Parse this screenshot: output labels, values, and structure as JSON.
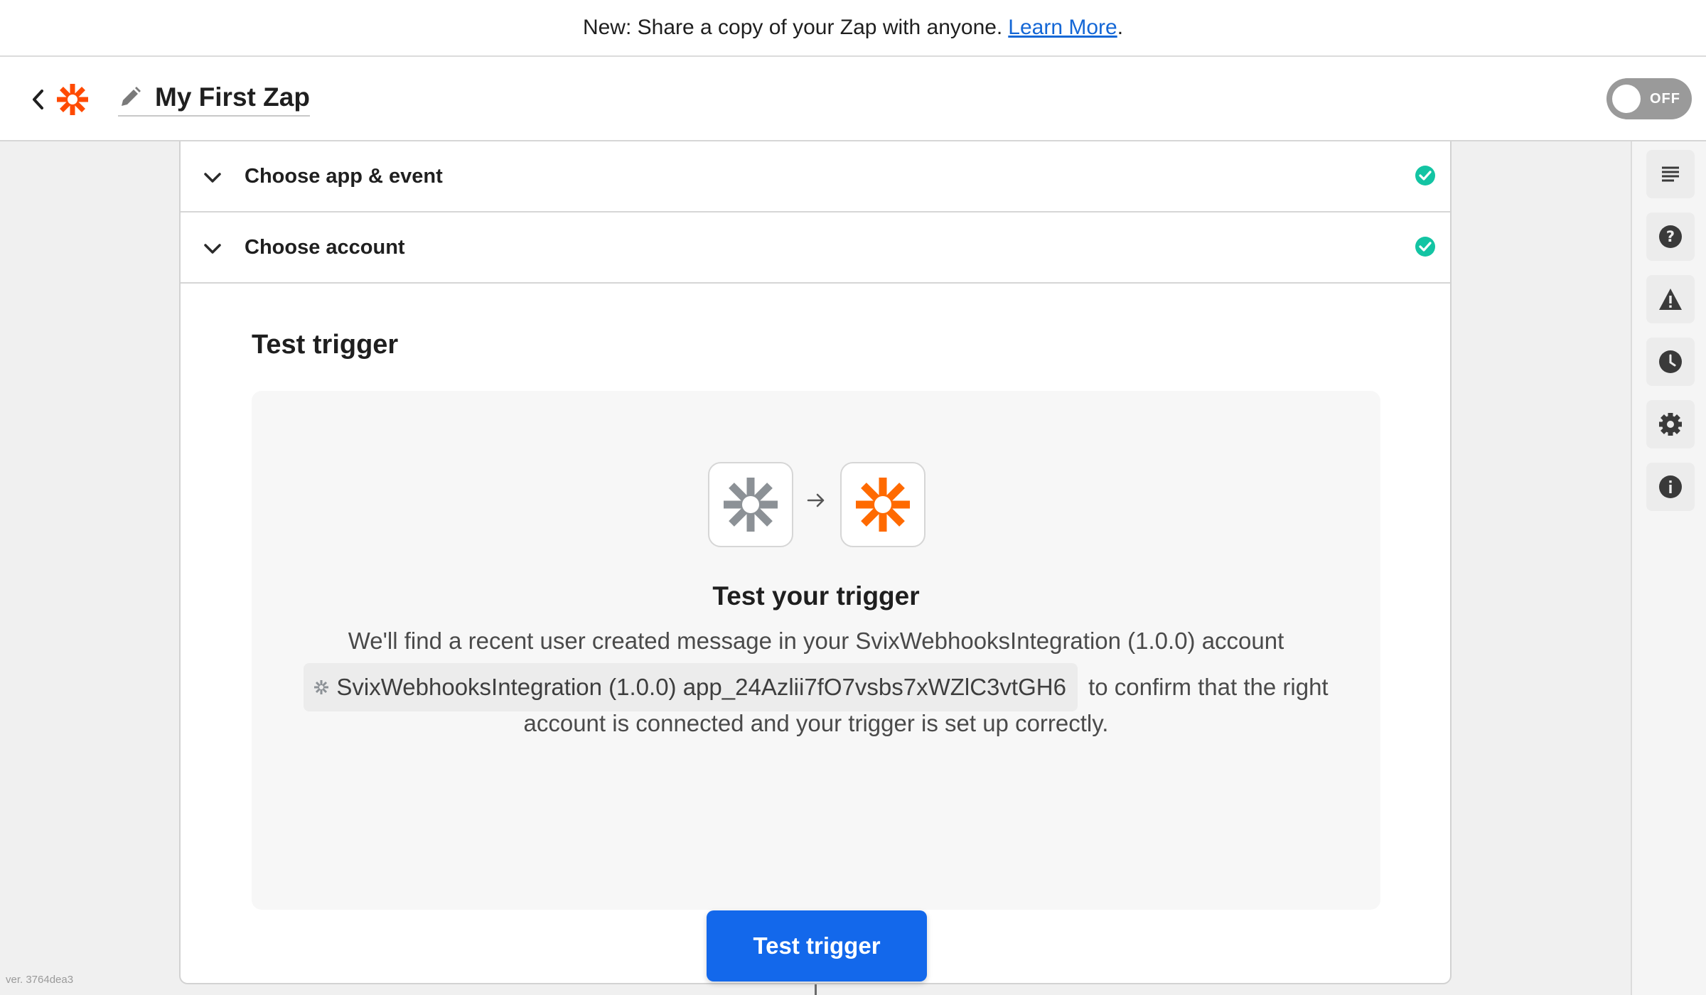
{
  "banner": {
    "text": "New: Share a copy of your Zap with anyone.",
    "link": "Learn More",
    "trailing": "."
  },
  "header": {
    "zap_name": "My First Zap",
    "toggle_label": "OFF",
    "logo_color": "#ff4a00"
  },
  "sections": [
    {
      "label": "Choose app & event",
      "status": "complete"
    },
    {
      "label": "Choose account",
      "status": "complete"
    }
  ],
  "test": {
    "heading": "Test trigger",
    "panel_title": "Test your trigger",
    "desc_line1": "We'll find a recent user created message in your SvixWebhooksIntegration (1.0.0) account",
    "account_pill": "SvixWebhooksIntegration (1.0.0) app_24Azlii7fO7vsbs7xWZlC3vtGH6",
    "desc_line2_tail": "to confirm that the right",
    "desc_line3": "account is connected and your trigger is set up correctly.",
    "button_label": "Test trigger"
  },
  "sidebar": {
    "icons": [
      "outline-icon",
      "help-icon",
      "warning-icon",
      "history-icon",
      "settings-icon",
      "info-icon"
    ]
  },
  "footer": {
    "version": "ver. 3764dea3"
  },
  "colors": {
    "accent": "#1368eb",
    "brand": "#ff4a00",
    "success": "#13c4a3",
    "link": "#1467d6"
  }
}
